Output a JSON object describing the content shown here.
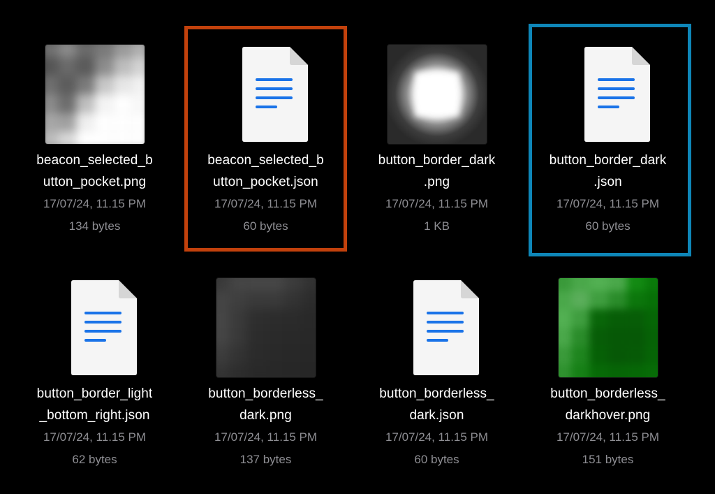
{
  "colors": {
    "background": "#000000",
    "name_text": "#ffffff",
    "meta_text": "#8e8e93",
    "selection_orange": "#c2410c",
    "selection_blue": "#0e86b8",
    "doc_lines": "#1a73e8"
  },
  "files": [
    {
      "name_line1": "beacon_selected_b",
      "name_line2": "utton_pocket.png",
      "date": "17/07/24, 11.15 PM",
      "size": "134 bytes",
      "kind": "image",
      "icon": "image-thumbnail"
    },
    {
      "name_line1": "beacon_selected_b",
      "name_line2": "utton_pocket.json",
      "date": "17/07/24, 11.15 PM",
      "size": "60 bytes",
      "kind": "document",
      "icon": "document-icon",
      "selection": "orange"
    },
    {
      "name_line1": "button_border_dark",
      "name_line2": ".png",
      "date": "17/07/24, 11.15 PM",
      "size": "1 KB",
      "kind": "image",
      "icon": "image-thumbnail"
    },
    {
      "name_line1": "button_border_dark",
      "name_line2": ".json",
      "date": "17/07/24, 11.15 PM",
      "size": "60 bytes",
      "kind": "document",
      "icon": "document-icon",
      "selection": "blue"
    },
    {
      "name_line1": "button_border_light",
      "name_line2": "_bottom_right.json",
      "date": "17/07/24, 11.15 PM",
      "size": "62 bytes",
      "kind": "document",
      "icon": "document-icon"
    },
    {
      "name_line1": "button_borderless_",
      "name_line2": "dark.png",
      "date": "17/07/24, 11.15 PM",
      "size": "137 bytes",
      "kind": "image",
      "icon": "image-thumbnail"
    },
    {
      "name_line1": "button_borderless_",
      "name_line2": "dark.json",
      "date": "17/07/24, 11.15 PM",
      "size": "60 bytes",
      "kind": "document",
      "icon": "document-icon"
    },
    {
      "name_line1": "button_borderless_",
      "name_line2": "darkhover.png",
      "date": "17/07/24, 11.15 PM",
      "size": "151 bytes",
      "kind": "image",
      "icon": "image-thumbnail"
    }
  ]
}
